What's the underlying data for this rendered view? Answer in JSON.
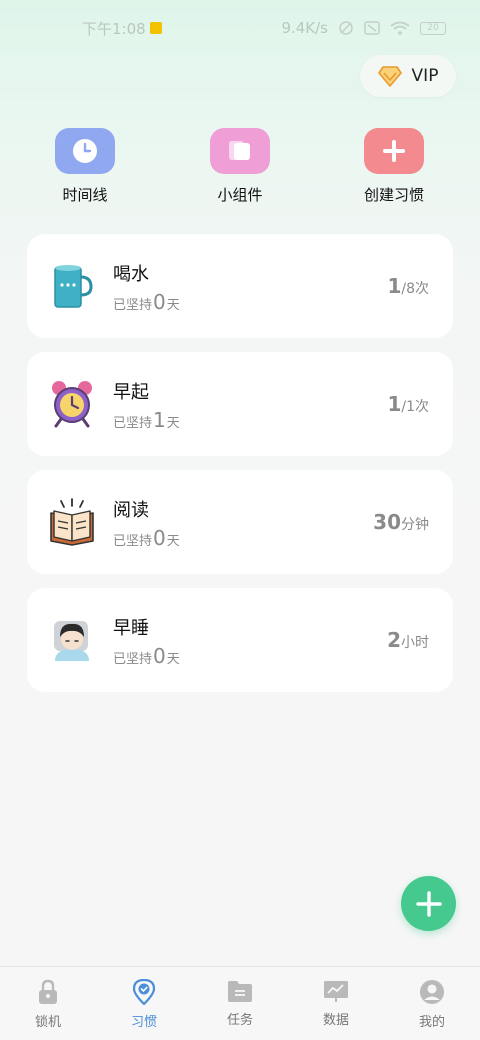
{
  "status_bar": {
    "time": "下午1:08",
    "network_speed": "9.4K/s",
    "battery": "20"
  },
  "vip": {
    "label": "VIP"
  },
  "shortcuts": [
    {
      "label": "时间线",
      "icon": "clock-icon",
      "color": "#8fa8f0"
    },
    {
      "label": "小组件",
      "icon": "widget-icon",
      "color": "#ef9fd6"
    },
    {
      "label": "创建习惯",
      "icon": "plus-icon",
      "color": "#f28a8f"
    }
  ],
  "habits": [
    {
      "name": "喝水",
      "streak_prefix": "已坚持",
      "streak_value": "0",
      "streak_unit": "天",
      "goal_value": "1",
      "goal_unit": "/8次",
      "icon": "water-cup-icon"
    },
    {
      "name": "早起",
      "streak_prefix": "已坚持",
      "streak_value": "1",
      "streak_unit": "天",
      "goal_value": "1",
      "goal_unit": "/1次",
      "icon": "alarm-clock-icon"
    },
    {
      "name": "阅读",
      "streak_prefix": "已坚持",
      "streak_value": "0",
      "streak_unit": "天",
      "goal_value": "30",
      "goal_unit": "分钟",
      "icon": "open-book-icon"
    },
    {
      "name": "早睡",
      "streak_prefix": "已坚持",
      "streak_value": "0",
      "streak_unit": "天",
      "goal_value": "2",
      "goal_unit": "小时",
      "icon": "sleeping-person-icon"
    }
  ],
  "bottom_nav": [
    {
      "label": "锁机",
      "icon": "lock-icon",
      "active": false
    },
    {
      "label": "习惯",
      "icon": "location-check-icon",
      "active": true
    },
    {
      "label": "任务",
      "icon": "folder-list-icon",
      "active": false
    },
    {
      "label": "数据",
      "icon": "chart-board-icon",
      "active": false
    },
    {
      "label": "我的",
      "icon": "profile-icon",
      "active": false
    }
  ],
  "colors": {
    "accent_green": "#45c98e",
    "active_nav": "#4a8fd8"
  }
}
